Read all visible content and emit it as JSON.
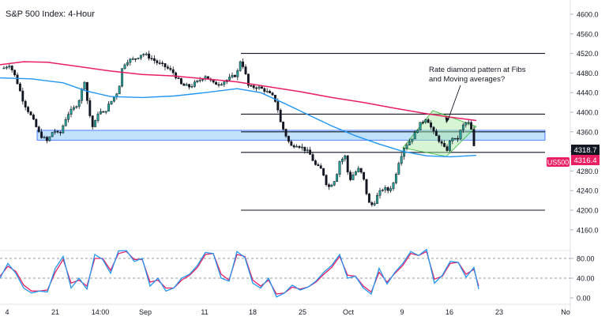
{
  "chart_data": {
    "type": "candlestick",
    "title": "S&P 500 Index: 4-Hour",
    "symbol": "US500",
    "last_price": "4316.4",
    "marker_price": "4318.7",
    "symbol_color": "#e91e63",
    "annotation": "Rate diamond pattern at Fibs and Moving averages?",
    "y_axis": {
      "ticks": [
        4160.0,
        4200.0,
        4240.0,
        4280.0,
        4320.0,
        4360.0,
        4400.0,
        4440.0,
        4480.0,
        4520.0,
        4560.0,
        4600.0
      ],
      "ylim": [
        4140,
        4615
      ]
    },
    "x_axis": {
      "ticks": [
        "4",
        "21",
        "14:00",
        "Sep",
        "11",
        "18",
        "25",
        "Oct",
        "9",
        "16",
        "23",
        "No"
      ]
    },
    "horizontal_levels": [
      4520.0,
      4396.0,
      4360.0,
      4318.0,
      4200.0
    ],
    "support_zone": [
      4343,
      4363
    ],
    "close_path": [
      [
        0,
        4485
      ],
      [
        12,
        4498
      ],
      [
        20,
        4470
      ],
      [
        30,
        4420
      ],
      [
        40,
        4390
      ],
      [
        50,
        4355
      ],
      [
        60,
        4340
      ],
      [
        68,
        4365
      ],
      [
        75,
        4352
      ],
      [
        85,
        4395
      ],
      [
        95,
        4410
      ],
      [
        100,
        4425
      ],
      [
        107,
        4465
      ],
      [
        112,
        4405
      ],
      [
        118,
        4365
      ],
      [
        125,
        4405
      ],
      [
        130,
        4395
      ],
      [
        140,
        4420
      ],
      [
        150,
        4445
      ],
      [
        155,
        4492
      ],
      [
        160,
        4505
      ],
      [
        170,
        4508
      ],
      [
        180,
        4520
      ],
      [
        190,
        4512
      ],
      [
        200,
        4500
      ],
      [
        210,
        4492
      ],
      [
        220,
        4480
      ],
      [
        230,
        4455
      ],
      [
        240,
        4452
      ],
      [
        250,
        4462
      ],
      [
        260,
        4475
      ],
      [
        270,
        4458
      ],
      [
        280,
        4460
      ],
      [
        290,
        4468
      ],
      [
        300,
        4478
      ],
      [
        305,
        4510
      ],
      [
        310,
        4482
      ],
      [
        315,
        4450
      ],
      [
        325,
        4452
      ],
      [
        335,
        4445
      ],
      [
        345,
        4432
      ],
      [
        350,
        4420
      ],
      [
        355,
        4380
      ],
      [
        360,
        4360
      ],
      [
        368,
        4330
      ],
      [
        375,
        4335
      ],
      [
        385,
        4325
      ],
      [
        392,
        4315
      ],
      [
        400,
        4290
      ],
      [
        408,
        4282
      ],
      [
        415,
        4245
      ],
      [
        425,
        4265
      ],
      [
        430,
        4300
      ],
      [
        437,
        4310
      ],
      [
        442,
        4260
      ],
      [
        448,
        4275
      ],
      [
        455,
        4285
      ],
      [
        462,
        4255
      ],
      [
        466,
        4215
      ],
      [
        472,
        4210
      ],
      [
        478,
        4230
      ],
      [
        485,
        4245
      ],
      [
        492,
        4240
      ],
      [
        498,
        4255
      ],
      [
        505,
        4300
      ],
      [
        512,
        4330
      ],
      [
        518,
        4340
      ],
      [
        525,
        4355
      ],
      [
        530,
        4372
      ],
      [
        540,
        4390
      ],
      [
        548,
        4360
      ],
      [
        555,
        4345
      ],
      [
        565,
        4320
      ],
      [
        572,
        4350
      ],
      [
        578,
        4340
      ],
      [
        585,
        4370
      ],
      [
        592,
        4382
      ],
      [
        597,
        4362
      ],
      [
        601,
        4318
      ]
    ],
    "ma_blue": [
      [
        0,
        4470
      ],
      [
        40,
        4468
      ],
      [
        80,
        4460
      ],
      [
        110,
        4443
      ],
      [
        140,
        4432
      ],
      [
        180,
        4430
      ],
      [
        220,
        4433
      ],
      [
        260,
        4440
      ],
      [
        300,
        4448
      ],
      [
        330,
        4440
      ],
      [
        360,
        4418
      ],
      [
        390,
        4395
      ],
      [
        420,
        4372
      ],
      [
        450,
        4352
      ],
      [
        480,
        4335
      ],
      [
        510,
        4320
      ],
      [
        540,
        4311
      ],
      [
        570,
        4309
      ],
      [
        603,
        4312
      ]
    ],
    "ma_red": [
      [
        0,
        4497
      ],
      [
        30,
        4503
      ],
      [
        60,
        4502
      ],
      [
        100,
        4493
      ],
      [
        140,
        4484
      ],
      [
        180,
        4477
      ],
      [
        220,
        4474
      ],
      [
        260,
        4468
      ],
      [
        300,
        4462
      ],
      [
        340,
        4452
      ],
      [
        380,
        4442
      ],
      [
        420,
        4430
      ],
      [
        460,
        4420
      ],
      [
        500,
        4408
      ],
      [
        540,
        4397
      ],
      [
        570,
        4390
      ],
      [
        603,
        4383
      ]
    ],
    "stochastic": {
      "levels": [
        80.0,
        40.0
      ],
      "ticks": [
        "80.00",
        "40.00",
        "0.00"
      ],
      "k": [
        [
          0,
          40
        ],
        [
          10,
          70
        ],
        [
          20,
          50
        ],
        [
          30,
          20
        ],
        [
          40,
          10
        ],
        [
          50,
          14
        ],
        [
          60,
          12
        ],
        [
          70,
          60
        ],
        [
          80,
          84
        ],
        [
          90,
          20
        ],
        [
          100,
          40
        ],
        [
          110,
          18
        ],
        [
          120,
          88
        ],
        [
          130,
          78
        ],
        [
          140,
          50
        ],
        [
          150,
          95
        ],
        [
          160,
          96
        ],
        [
          170,
          74
        ],
        [
          180,
          80
        ],
        [
          190,
          24
        ],
        [
          200,
          40
        ],
        [
          210,
          14
        ],
        [
          220,
          20
        ],
        [
          230,
          40
        ],
        [
          240,
          48
        ],
        [
          250,
          66
        ],
        [
          260,
          92
        ],
        [
          270,
          90
        ],
        [
          280,
          40
        ],
        [
          290,
          34
        ],
        [
          300,
          94
        ],
        [
          310,
          82
        ],
        [
          320,
          30
        ],
        [
          330,
          20
        ],
        [
          340,
          40
        ],
        [
          350,
          2
        ],
        [
          360,
          10
        ],
        [
          370,
          26
        ],
        [
          380,
          16
        ],
        [
          390,
          22
        ],
        [
          400,
          34
        ],
        [
          410,
          52
        ],
        [
          420,
          66
        ],
        [
          430,
          88
        ],
        [
          440,
          40
        ],
        [
          450,
          44
        ],
        [
          460,
          20
        ],
        [
          470,
          8
        ],
        [
          480,
          60
        ],
        [
          490,
          28
        ],
        [
          500,
          52
        ],
        [
          510,
          70
        ],
        [
          520,
          94
        ],
        [
          530,
          86
        ],
        [
          540,
          98
        ],
        [
          550,
          30
        ],
        [
          560,
          46
        ],
        [
          570,
          74
        ],
        [
          580,
          72
        ],
        [
          590,
          42
        ],
        [
          600,
          62
        ],
        [
          606,
          18
        ]
      ],
      "d": [
        [
          0,
          44
        ],
        [
          10,
          64
        ],
        [
          20,
          54
        ],
        [
          30,
          26
        ],
        [
          40,
          14
        ],
        [
          50,
          14
        ],
        [
          60,
          16
        ],
        [
          70,
          52
        ],
        [
          80,
          78
        ],
        [
          90,
          30
        ],
        [
          100,
          36
        ],
        [
          110,
          24
        ],
        [
          120,
          80
        ],
        [
          130,
          80
        ],
        [
          140,
          56
        ],
        [
          150,
          90
        ],
        [
          160,
          94
        ],
        [
          170,
          78
        ],
        [
          180,
          78
        ],
        [
          190,
          32
        ],
        [
          200,
          36
        ],
        [
          210,
          20
        ],
        [
          220,
          20
        ],
        [
          230,
          36
        ],
        [
          240,
          46
        ],
        [
          250,
          62
        ],
        [
          260,
          88
        ],
        [
          270,
          90
        ],
        [
          280,
          48
        ],
        [
          290,
          36
        ],
        [
          300,
          88
        ],
        [
          310,
          84
        ],
        [
          320,
          36
        ],
        [
          330,
          24
        ],
        [
          340,
          36
        ],
        [
          350,
          8
        ],
        [
          360,
          10
        ],
        [
          370,
          22
        ],
        [
          380,
          18
        ],
        [
          390,
          22
        ],
        [
          400,
          32
        ],
        [
          410,
          48
        ],
        [
          420,
          62
        ],
        [
          430,
          84
        ],
        [
          440,
          46
        ],
        [
          450,
          44
        ],
        [
          460,
          24
        ],
        [
          470,
          12
        ],
        [
          480,
          52
        ],
        [
          490,
          32
        ],
        [
          500,
          50
        ],
        [
          510,
          66
        ],
        [
          520,
          90
        ],
        [
          530,
          86
        ],
        [
          540,
          94
        ],
        [
          550,
          38
        ],
        [
          560,
          44
        ],
        [
          570,
          70
        ],
        [
          580,
          72
        ],
        [
          590,
          48
        ],
        [
          600,
          58
        ],
        [
          606,
          24
        ]
      ]
    }
  }
}
